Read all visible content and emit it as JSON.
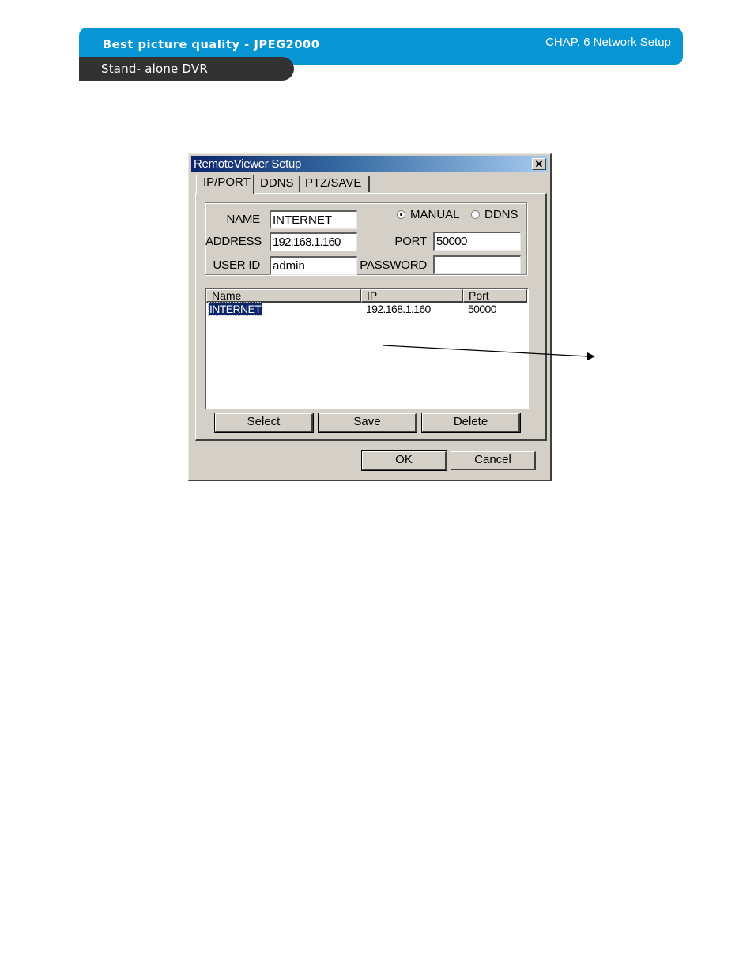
{
  "header": {
    "title": "Best picture quality -  JPEG2000",
    "chapter": "CHAP.  6  Network Setup",
    "subtitle": "Stand- alone DVR",
    "colors": {
      "banner": "#0796d3",
      "subbar": "#323232"
    }
  },
  "dialog": {
    "title": "RemoteViewer Setup",
    "close_icon": "close-icon",
    "tabs": [
      {
        "label": "IP/PORT",
        "active": true
      },
      {
        "label": "DDNS",
        "active": false
      },
      {
        "label": "PTZ/SAVE",
        "active": false
      }
    ],
    "form": {
      "name_label": "NAME",
      "name_value": "INTERNET",
      "address_label": "ADDRESS",
      "address_value": "192.168.1.160",
      "userid_label": "USER ID",
      "userid_value": "admin",
      "port_label": "PORT",
      "port_value": "50000",
      "password_label": "PASSWORD",
      "password_value": "",
      "mode_options": [
        {
          "label": "MANUAL",
          "selected": true
        },
        {
          "label": "DDNS",
          "selected": false
        }
      ]
    },
    "list": {
      "columns": [
        "Name",
        "IP",
        "Port"
      ],
      "rows": [
        {
          "name": "INTERNET",
          "ip": "192.168.1.160",
          "port": "50000",
          "selected": true
        }
      ]
    },
    "list_buttons": {
      "select": "Select",
      "save": "Save",
      "delete": "Delete"
    },
    "footer_buttons": {
      "ok": "OK",
      "cancel": "Cancel"
    },
    "colors": {
      "face": "#d4d0c8",
      "titlebar_start": "#0a246a",
      "titlebar_end": "#a6caf0",
      "selection": "#0a246a"
    }
  }
}
